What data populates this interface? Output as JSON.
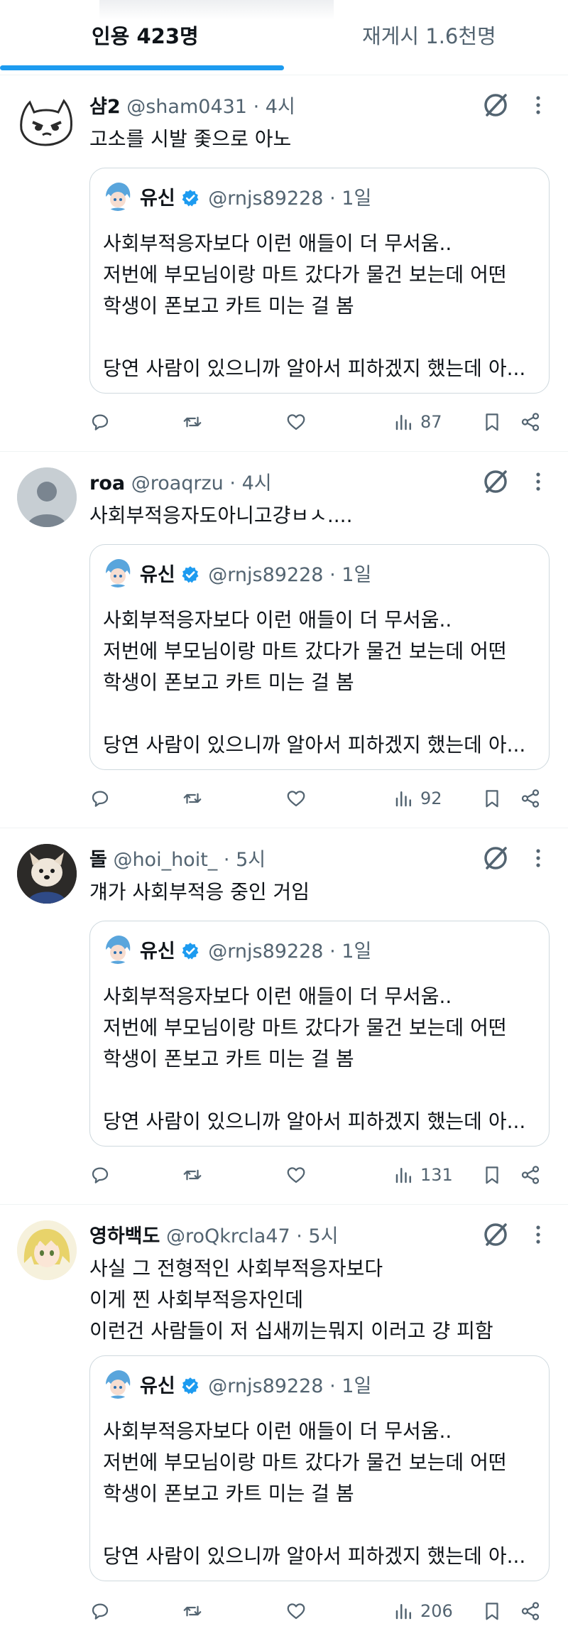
{
  "tabs": {
    "quotes": "인용 423명",
    "reposts": "재게시 1.6천명"
  },
  "quoted_tweet": {
    "name": "유신",
    "handle": "@rnjs89228",
    "dot": "·",
    "time": "1일",
    "lines": [
      "사회부적응자보다 이런 애들이 더 무서움..",
      "저번에 부모님이랑 마트 갔다가 물건 보는데 어떤",
      "학생이 폰보고 카트 미는 걸 봄",
      "",
      "당연 사람이 있으니까 알아서 피하겠지 했는데 아..."
    ]
  },
  "tweets": [
    {
      "name": "샴2",
      "handle": "@sham0431",
      "dot": "·",
      "time": "4시",
      "lines": [
        "고소를 시발 좇으로 아노"
      ],
      "views": "87"
    },
    {
      "name": "roa",
      "handle": "@roaqrzu",
      "dot": "·",
      "time": "4시",
      "lines": [
        "사회부적응자도아니고걍ㅂㅅ...."
      ],
      "views": "92"
    },
    {
      "name": "돌",
      "handle": "@hoi_hoit_",
      "dot": "·",
      "time": "5시",
      "lines": [
        "걔가 사회부적응 중인 거임"
      ],
      "views": "131"
    },
    {
      "name": "영하백도",
      "handle": "@roQkrcla47",
      "dot": "·",
      "time": "5시",
      "lines": [
        "사실 그 전형적인 사회부적응자보다",
        "이게 찐 사회부적응자인데",
        "이런건 사람들이 저 십새끼는뭐지 이러고  걍 피함"
      ],
      "views": "206"
    }
  ],
  "icons": {
    "grok": "grok-icon",
    "more": "more-icon",
    "reply": "reply-icon",
    "repost": "repost-icon",
    "like": "like-icon",
    "views": "views-icon",
    "bookmark": "bookmark-icon",
    "share": "share-icon",
    "verified": "verified-badge-icon"
  },
  "colors": {
    "accent": "#1d9bf0",
    "text": "#0f1419",
    "secondary": "#536471",
    "border": "#cfd9de"
  }
}
